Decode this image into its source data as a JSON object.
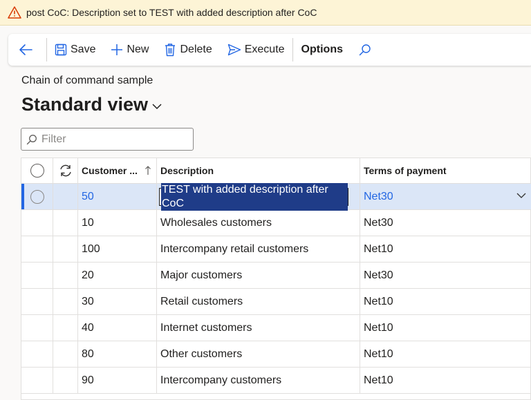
{
  "warning": {
    "message": "post CoC: Description set to TEST with added description after CoC",
    "color": "#d83b01"
  },
  "toolbar": {
    "back_icon": "back-arrow-icon",
    "save_label": "Save",
    "new_label": "New",
    "delete_label": "Delete",
    "execute_label": "Execute",
    "options_label": "Options"
  },
  "page": {
    "caption": "Chain of command sample",
    "view_name": "Standard view"
  },
  "filter": {
    "placeholder": "Filter",
    "value": ""
  },
  "grid": {
    "columns": {
      "customer": "Customer ...",
      "description": "Description",
      "terms": "Terms of payment"
    },
    "rows": [
      {
        "customer": "50",
        "description": "TEST with added description after CoC",
        "terms": "Net30"
      },
      {
        "customer": "10",
        "description": "Wholesales customers",
        "terms": "Net30"
      },
      {
        "customer": "100",
        "description": "Intercompany retail customers",
        "terms": "Net10"
      },
      {
        "customer": "20",
        "description": "Major customers",
        "terms": "Net30"
      },
      {
        "customer": "30",
        "description": "Retail customers",
        "terms": "Net10"
      },
      {
        "customer": "40",
        "description": "Internet customers",
        "terms": "Net10"
      },
      {
        "customer": "80",
        "description": "Other customers",
        "terms": "Net10"
      },
      {
        "customer": "90",
        "description": "Intercompany  customers",
        "terms": "Net10"
      }
    ]
  },
  "colors": {
    "accent": "#2266e3",
    "selected_row": "#dbe6f7",
    "warning_bg": "#fdf4d6"
  }
}
